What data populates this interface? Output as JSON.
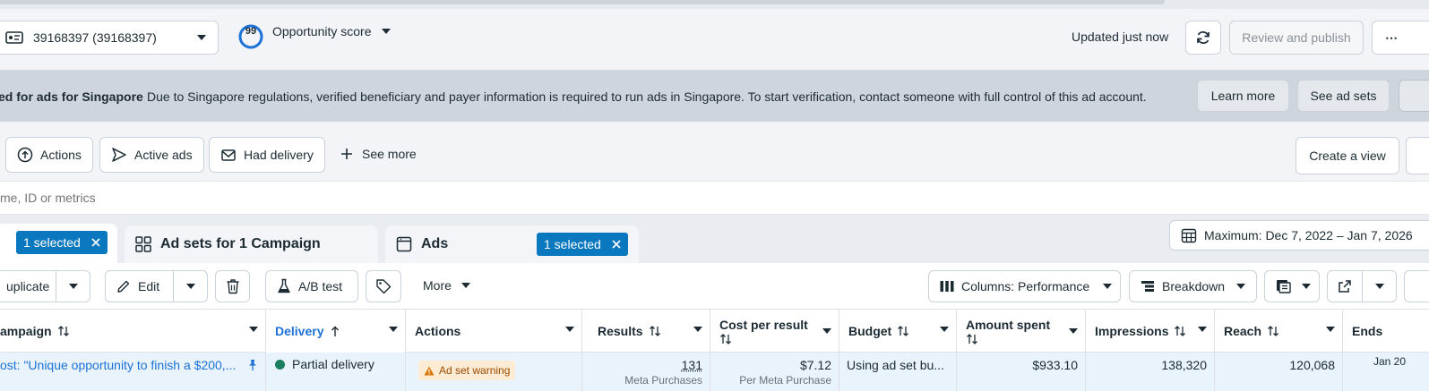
{
  "header": {
    "account": "39168397 (39168397)",
    "opportunity_score": "99",
    "opportunity_label": "Opportunity score",
    "updated": "Updated just now",
    "review_publish": "Review and publish",
    "more": "⋯"
  },
  "banner": {
    "title": "ed for ads for Singapore",
    "text": "Due to Singapore regulations, verified beneficiary and payer information is required to run ads in Singapore. To start verification, contact someone with full control of this ad account.",
    "learn_more": "Learn more",
    "see_ad_sets": "See ad sets"
  },
  "filters": {
    "actions": "Actions",
    "active_ads": "Active ads",
    "had_delivery": "Had delivery",
    "see_more": "See more",
    "create_view": "Create a view"
  },
  "search": {
    "placeholder": "me, ID or metrics"
  },
  "tabs": {
    "campaigns_selected": "1 selected",
    "adsets": "Ad sets for 1 Campaign",
    "ads": "Ads",
    "ads_selected": "1 selected"
  },
  "date_range": "Maximum: Dec 7, 2022 – Jan 7, 2026",
  "toolbar": {
    "duplicate": "uplicate",
    "edit": "Edit",
    "ab_test": "A/B test",
    "more": "More",
    "columns": "Columns: Performance",
    "breakdown": "Breakdown"
  },
  "table": {
    "headers": {
      "campaign": "ampaign",
      "delivery": "Delivery",
      "actions": "Actions",
      "results": "Results",
      "cost_line1": "Cost per result",
      "budget": "Budget",
      "amount_line1": "Amount spent",
      "impressions": "Impressions",
      "reach": "Reach",
      "ends": "Ends"
    },
    "row": {
      "campaign": "ost: \"Unique opportunity to finish a $200,...",
      "delivery": "Partial delivery",
      "actions": "Ad set warning",
      "results": "131",
      "results_sub": "Meta Purchases",
      "cost": "$7.12",
      "cost_sub": "Per Meta Purchase",
      "budget": "Using ad set bu...",
      "amount": "$933.10",
      "impressions": "138,320",
      "reach": "120,068",
      "ends": "Jan 20"
    }
  },
  "colors": {
    "accent": "#0a78be",
    "blue_link": "#1d72d8",
    "green": "#1a7f5e",
    "warning": "#d97706"
  }
}
